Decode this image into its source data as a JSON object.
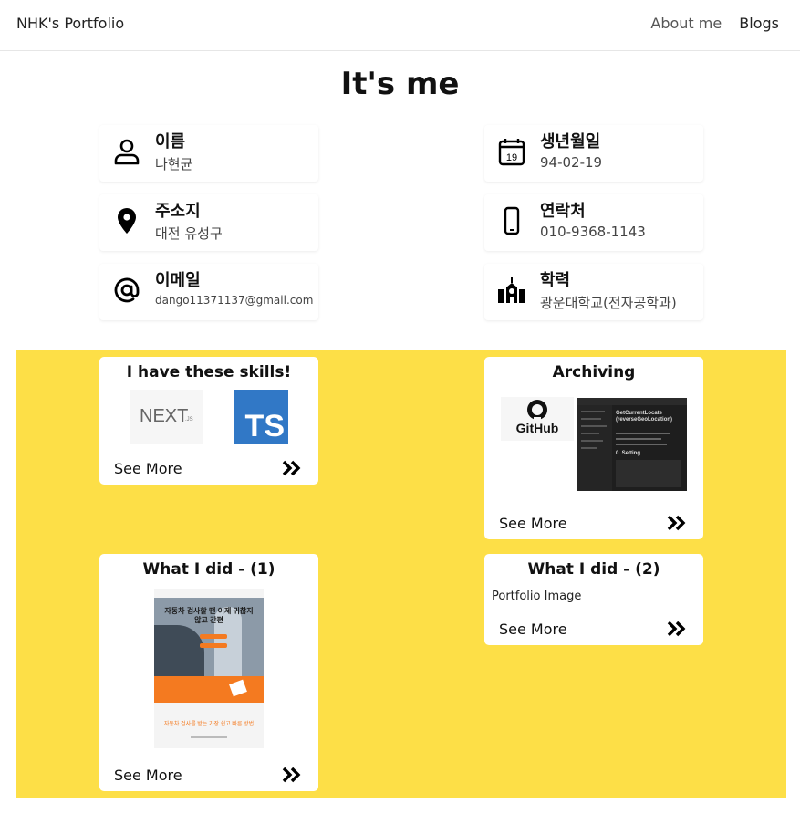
{
  "nav": {
    "brand": "NHK's Portfolio",
    "about": "About me",
    "blogs": "Blogs"
  },
  "page_title": "It's me",
  "info": {
    "name_label": "이름",
    "name_value": "나현균",
    "birth_label": "생년월일",
    "birth_value": "94-02-19",
    "calendar_day": "19",
    "address_label": "주소지",
    "address_value": "대전 유성구",
    "contact_label": "연락처",
    "contact_value": "010-9368-1143",
    "email_label": "이메일",
    "email_value": "dango11371137@gmail.com",
    "edu_label": "학력",
    "edu_value": "광운대학교(전자공학과)"
  },
  "cards": {
    "skills": {
      "title": "I have these skills!",
      "next_logo": "NEXT",
      "next_sub": ".JS",
      "ts_logo": "TS",
      "see_more": "See More"
    },
    "archiving": {
      "title": "Archiving",
      "github_label": "GitHub",
      "blog_heading": "GetCurrentLocate (reverseGeoLocation)",
      "blog_section": "0. Setting",
      "see_more": "See More"
    },
    "did1": {
      "title": "What I did - (1)",
      "promo_head": "자동차 검사할 땐 이제 귀찮지 않고 간편",
      "promo_foot": "자동차 검사를 받는 가장 쉽고 빠른 방법",
      "see_more": "See More"
    },
    "did2": {
      "title": "What I did - (2)",
      "image_alt": "Portfolio Image",
      "see_more": "See More"
    }
  },
  "colors": {
    "yellow": "#fddf47",
    "ts_blue": "#3178c6",
    "promo_orange": "#f47a20"
  },
  "icons": [
    "user-icon",
    "calendar-icon",
    "location-icon",
    "phone-icon",
    "at-icon",
    "school-icon",
    "double-chevron-right-icon",
    "github-icon"
  ]
}
